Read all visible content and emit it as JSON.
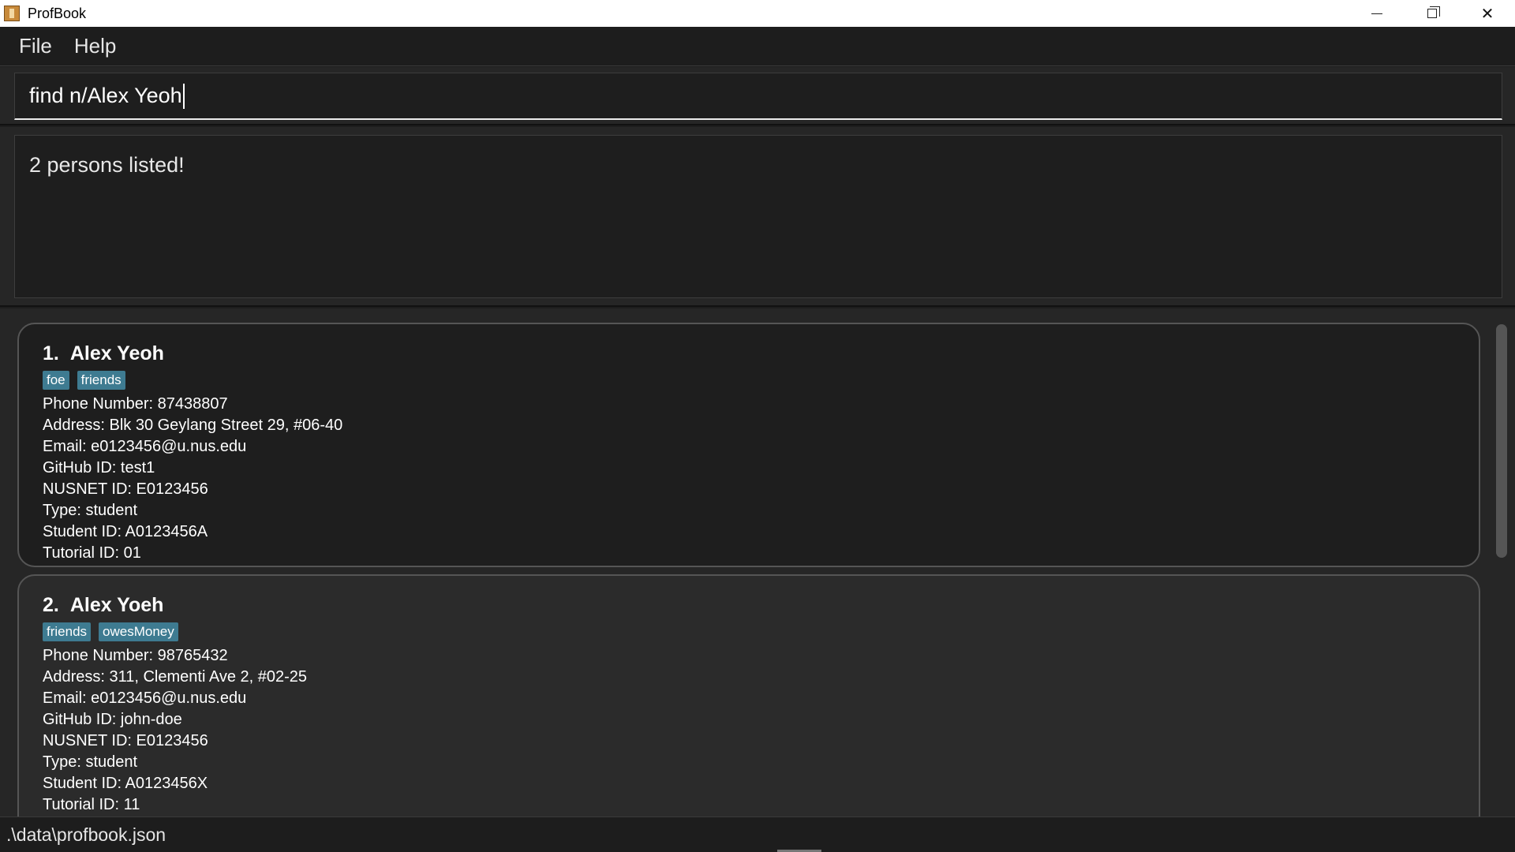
{
  "window": {
    "title": "ProfBook",
    "icon": "profbook-app-icon",
    "controls": {
      "minimize": "minimize-icon",
      "maximize": "restore-icon",
      "close": "close-icon"
    }
  },
  "menu": {
    "file": "File",
    "help": "Help"
  },
  "command": {
    "value": "find n/Alex Yeoh"
  },
  "result": {
    "message": "2 persons listed!"
  },
  "persons": [
    {
      "index": "1.",
      "name": "Alex Yeoh",
      "tags": [
        "foe",
        "friends"
      ],
      "phone": "Phone Number: 87438807",
      "address": "Address: Blk 30 Geylang Street 29, #06-40",
      "email": "Email: e0123456@u.nus.edu",
      "github": "GitHub ID: test1",
      "nusnet": "NUSNET ID: E0123456",
      "type": "Type: student",
      "student_id": "Student ID: A0123456A",
      "tutorial_id": "Tutorial ID: 01"
    },
    {
      "index": "2.",
      "name": "Alex Yoeh",
      "tags": [
        "friends",
        "owesMoney"
      ],
      "phone": "Phone Number: 98765432",
      "address": "Address: 311, Clementi Ave 2, #02-25",
      "email": "Email: e0123456@u.nus.edu",
      "github": "GitHub ID: john-doe",
      "nusnet": "NUSNET ID: E0123456",
      "type": "Type: student",
      "student_id": "Student ID: A0123456X",
      "tutorial_id": "Tutorial ID: 11"
    }
  ],
  "status": {
    "path": ".\\data\\profbook.json"
  },
  "colors": {
    "tag_bg": "#3e7b91",
    "background": "#1d1d1d",
    "panel": "#262626"
  }
}
